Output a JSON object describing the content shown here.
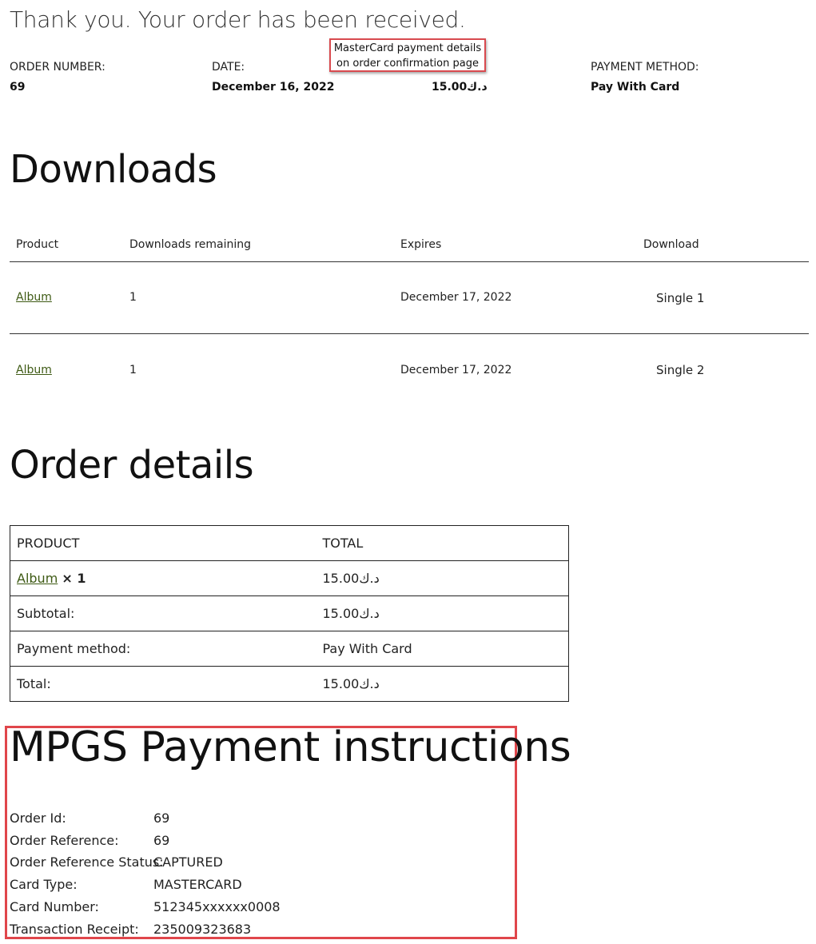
{
  "header": {
    "thank_you": "Thank you. Your order has been received.",
    "order_number_label": "ORDER NUMBER:",
    "order_number_value": "69",
    "date_label": "DATE:",
    "date_value": "December 16, 2022",
    "total_value": "15.00د.ك",
    "payment_method_label": "PAYMENT METHOD:",
    "payment_method_value": "Pay With Card",
    "callout_line1": "MasterCard payment details",
    "callout_line2": "on order confirmation page"
  },
  "downloads": {
    "title": "Downloads",
    "columns": [
      "Product",
      "Downloads remaining",
      "Expires",
      "Download"
    ],
    "rows": [
      {
        "product": "Album",
        "remaining": "1",
        "expires": "December 17, 2022",
        "download": "Single 1"
      },
      {
        "product": "Album",
        "remaining": "1",
        "expires": "December 17, 2022",
        "download": "Single 2"
      }
    ]
  },
  "order_details": {
    "title": "Order details",
    "col_product": "PRODUCT",
    "col_total": "TOTAL",
    "item_name": "Album",
    "item_qty": "× 1",
    "item_total": "15.00د.ك",
    "subtotal_label": "Subtotal:",
    "subtotal_value": "15.00د.ك",
    "payment_method_label": "Payment method:",
    "payment_method_value": "Pay With Card",
    "total_label": "Total:",
    "total_value": "15.00د.ك"
  },
  "mpgs": {
    "title": "MPGS Payment instructions",
    "rows": [
      {
        "label": "Order Id:",
        "value": "69"
      },
      {
        "label": "Order Reference:",
        "value": "69"
      },
      {
        "label": "Order Reference Status:",
        "value": "CAPTURED"
      },
      {
        "label": "Card Type:",
        "value": "MASTERCARD"
      },
      {
        "label": "Card Number:",
        "value": "512345xxxxxx0008"
      },
      {
        "label": "Transaction Receipt:",
        "value": "235009323683"
      }
    ]
  },
  "colors": {
    "link": "#3e5a14",
    "highlight_border": "#e0464b"
  }
}
